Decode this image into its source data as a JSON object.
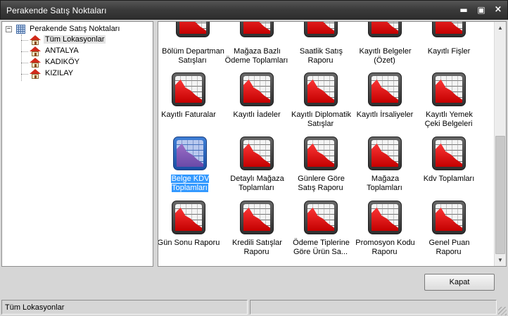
{
  "window": {
    "title": "Perakende Satış Noktaları",
    "controls": {
      "minimize": "▬",
      "maximize": "▣",
      "close": "×"
    }
  },
  "tree": {
    "expander": "−",
    "root_label": "Perakende Satış Noktaları",
    "items": [
      {
        "label": "Tüm Lokasyonlar",
        "selected": true
      },
      {
        "label": "ANTALYA"
      },
      {
        "label": "KADIKÖY"
      },
      {
        "label": "KIZILAY"
      }
    ]
  },
  "reports": {
    "row1": [
      "Bölüm Departman Satışları",
      "Mağaza Bazlı Ödeme Toplamları",
      "Saatlik Satış Raporu",
      "Kayıtlı Belgeler (Özet)",
      "Kayıtlı Fişler"
    ],
    "row2": [
      "Kayıtlı Faturalar",
      "Kayıtlı İadeler",
      "Kayıtlı Diplomatik Satışlar",
      "Kayıtlı İrsaliyeler",
      "Kayıtlı Yemek Çeki Belgeleri"
    ],
    "row3": [
      "Belge KDV Toplamları",
      "Detaylı Mağaza Toplamları",
      "Günlere Göre Satış Raporu",
      "Mağaza Toplamları",
      "Kdv Toplamları"
    ],
    "row4": [
      "Gün Sonu Raporu",
      "Kredili Satışlar Raporu",
      "Ödeme Tiplerine Göre Ürün Sa...",
      "Promosyon Kodu Raporu",
      "Genel Puan Raporu"
    ],
    "selected_label": "Belge KDV Toplamları"
  },
  "scrollbar": {
    "up": "▲",
    "down": "▼"
  },
  "buttons": {
    "close_label": "Kapat"
  },
  "status": {
    "left": "Tüm Lokasyonlar",
    "right": ""
  },
  "colors": {
    "titlebar": "#3a3a3a",
    "selection": "#3399ff",
    "icon_chart": "#e02020"
  }
}
